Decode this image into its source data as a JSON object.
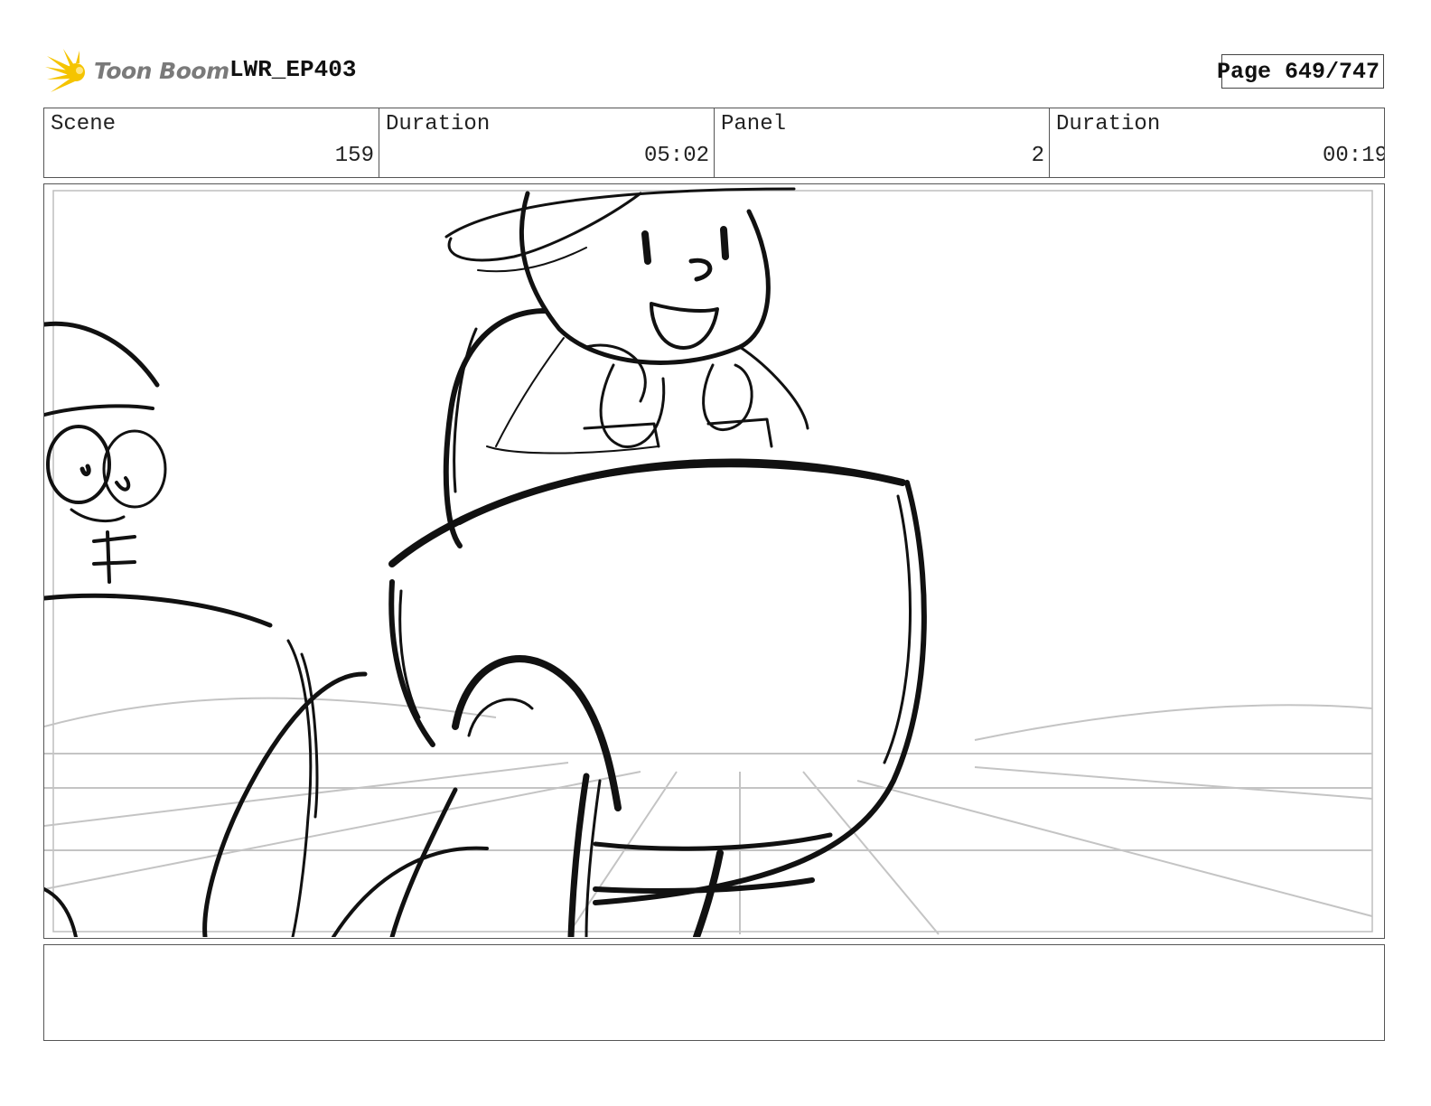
{
  "header": {
    "logo_text": "Toon Boom",
    "project_title": "LWR_EP403",
    "page_label": "Page 649/747"
  },
  "info": [
    {
      "label": "Scene",
      "value": "159"
    },
    {
      "label": "Duration",
      "value": "05:02"
    },
    {
      "label": "Panel",
      "value": "2"
    },
    {
      "label": "Duration",
      "value": "00:19"
    }
  ],
  "panel": {
    "content": "storyboard sketch",
    "sketch_stroke_color": "#111111",
    "guide_line_color": "#c4c4c4"
  },
  "notes": {
    "text": ""
  },
  "colors": {
    "logo_yellow": "#f5c400",
    "logo_text_gray": "#7a7a7a",
    "border": "#555555"
  }
}
